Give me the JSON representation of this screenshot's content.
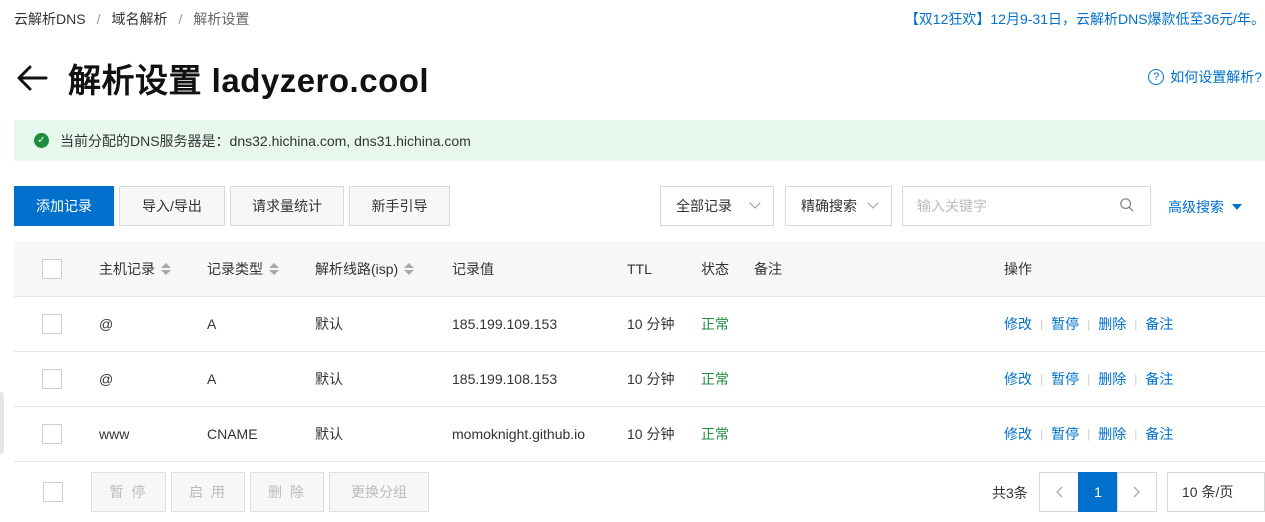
{
  "breadcrumb": {
    "items": [
      "云解析DNS",
      "域名解析",
      "解析设置"
    ]
  },
  "promo": "【双12狂欢】12月9-31日，云解析DNS爆款低至36元/年。",
  "page": {
    "title": "解析设置 ladyzero.cool",
    "help_link": "如何设置解析?"
  },
  "notice": {
    "text": "当前分配的DNS服务器是：dns32.hichina.com, dns31.hichina.com"
  },
  "toolbar": {
    "add_label": "添加记录",
    "import_export_label": "导入/导出",
    "stats_label": "请求量统计",
    "guide_label": "新手引导",
    "filter_value": "全部记录",
    "search_mode_value": "精确搜索",
    "search_placeholder": "输入关键字",
    "advanced_label": "高级搜索"
  },
  "table": {
    "headers": {
      "host": "主机记录",
      "type": "记录类型",
      "line": "解析线路(isp)",
      "value": "记录值",
      "ttl": "TTL",
      "status": "状态",
      "remark": "备注",
      "actions": "操作"
    },
    "rows": [
      {
        "host": "@",
        "type": "A",
        "line": "默认",
        "value": "185.199.109.153",
        "ttl": "10 分钟",
        "status": "正常"
      },
      {
        "host": "@",
        "type": "A",
        "line": "默认",
        "value": "185.199.108.153",
        "ttl": "10 分钟",
        "status": "正常"
      },
      {
        "host": "www",
        "type": "CNAME",
        "line": "默认",
        "value": "momoknight.github.io",
        "ttl": "10 分钟",
        "status": "正常"
      }
    ],
    "row_actions": {
      "edit": "修改",
      "pause": "暂停",
      "delete": "删除",
      "remark": "备注"
    }
  },
  "footer": {
    "pause_label": "暂 停",
    "enable_label": "启 用",
    "delete_label": "删 除",
    "change_group_label": "更换分组",
    "total_text": "共3条",
    "current_page": "1",
    "page_size_value": "10 条/页"
  },
  "colors": {
    "accent": "#0070cc",
    "success": "#1e8e3e",
    "notice_bg": "#e8f7ec"
  }
}
